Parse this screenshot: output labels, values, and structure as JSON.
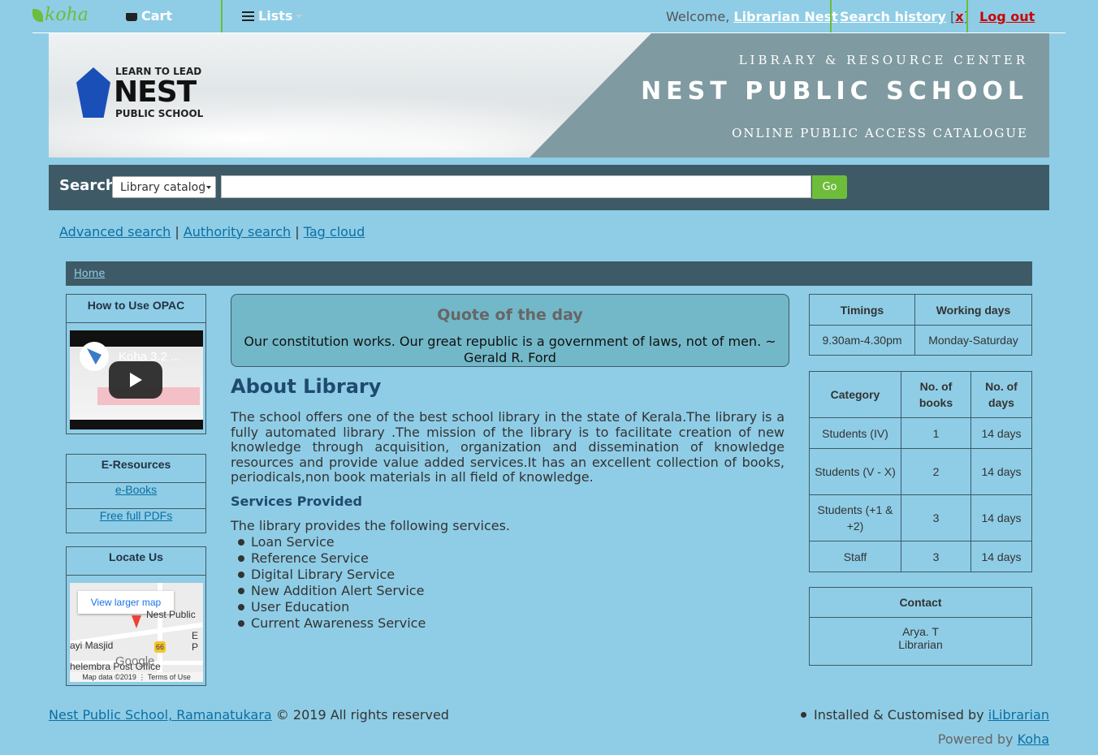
{
  "nav": {
    "logo": "koha",
    "cart": "Cart",
    "lists": "Lists",
    "welcome_prefix": "Welcome,",
    "user": "Librarian Nest",
    "search_history": "Search history",
    "sh_open": "[",
    "sh_clear": "x",
    "sh_close": "]",
    "logout": "Log out"
  },
  "banner": {
    "line1": "LIBRARY & RESOURCE CENTER",
    "line2": "NEST PUBLIC SCHOOL",
    "line3": "ONLINE PUBLIC ACCESS CATALOGUE",
    "logo_top": "LEARN TO LEAD",
    "logo_mid": "NEST",
    "logo_bot": "PUBLIC SCHOOL"
  },
  "search": {
    "label": "Search",
    "scope": "Library catalog",
    "query": "",
    "go": "Go"
  },
  "more_searches": [
    "Advanced search",
    "Authority search",
    "Tag cloud"
  ],
  "more_searches_sep": "|",
  "breadcrumb": "Home",
  "left": {
    "howto_title": "How to Use OPAC",
    "video_title": "Koha 3.2 ...",
    "eres_title": "E-Resources",
    "eres_links": [
      "e-Books",
      "Free full PDFs"
    ],
    "locate_title": "Locate Us",
    "map": {
      "view_larger": "View larger map",
      "place1": "Nest Public",
      "place2": "ayi Masjid",
      "place3": "helembra Post Office",
      "route": "66",
      "e": "E",
      "p": "P",
      "brand": "Google",
      "footer": "Map data ©2019 ⋮ Terms of Use"
    }
  },
  "quote": {
    "title": "Quote of the day",
    "text": "Our constitution works. Our great republic is a government of laws, not of men. ~ Gerald R. Ford"
  },
  "about": {
    "heading": "About Library",
    "para": "The school offers one of the best school library in the state of Kerala.The library is a fully automated library .The mission of the library is to facilitate creation of new knowledge through acquisition, organization and dissemination of knowledge resources and provide value added services.It has an excellent collection of books, periodicals,non book materials in all field of knowledge.",
    "services_heading": "Services Provided",
    "services_intro": "The library provides the following services.",
    "services": [
      "Loan Service",
      "Reference Service",
      "Digital Library Service",
      "New Addition Alert Service",
      "User Education",
      "Current Awareness Service"
    ]
  },
  "timings": {
    "headers": [
      "Timings",
      "Working days"
    ],
    "row": [
      "9.30am-4.30pm",
      "Monday-Saturday"
    ]
  },
  "borrowing": {
    "headers": [
      "Category",
      "No. of books",
      "No. of days"
    ],
    "rows": [
      [
        "Students (IV)",
        "1",
        "14 days"
      ],
      [
        "Students (V - X)",
        "2",
        "14 days"
      ],
      [
        "Students (+1 & +2)",
        "3",
        "14 days"
      ],
      [
        "Staff",
        "3",
        "14 days"
      ]
    ]
  },
  "contact": {
    "title": "Contact",
    "name": "Arya. T",
    "role": "Librarian"
  },
  "footer": {
    "school_link": "Nest Public School, Ramanatukara",
    "copyright": "© 2019 All rights reserved",
    "installed_prefix": "Installed & Customised by",
    "installed_link": "iLibrarian",
    "powered_prefix": "Powered by",
    "powered_link": "Koha"
  }
}
